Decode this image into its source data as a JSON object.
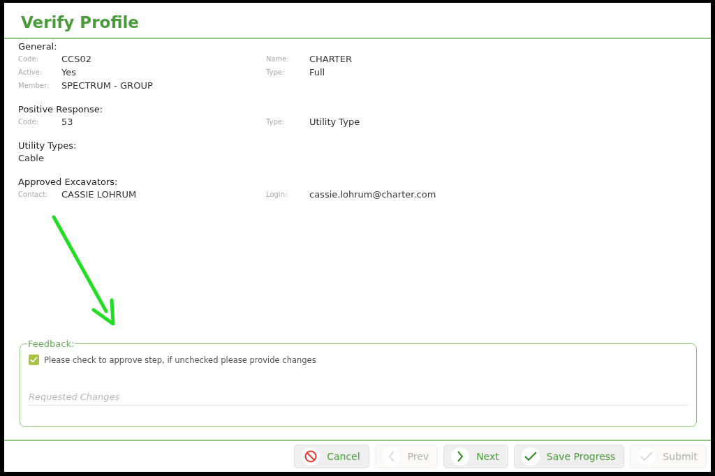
{
  "window": {
    "title": "Verify Profile"
  },
  "sections": [
    {
      "heading": "General:",
      "rows": [
        [
          {
            "label": "Code:",
            "value": "CCS02"
          },
          {
            "label": "Name:",
            "value": "CHARTER"
          }
        ],
        [
          {
            "label": "Active:",
            "value": "Yes"
          },
          {
            "label": "Type:",
            "value": "Full"
          }
        ],
        [
          {
            "label": "Member:",
            "value": "SPECTRUM - GROUP"
          }
        ]
      ]
    },
    {
      "heading": "Positive Response:",
      "rows": [
        [
          {
            "label": "Code:",
            "value": "53"
          },
          {
            "label": "Type:",
            "value": "Utility Type"
          }
        ]
      ]
    },
    {
      "heading": "Utility Types:",
      "text": "Cable"
    },
    {
      "heading": "Approved Excavators:",
      "rows": [
        [
          {
            "label": "Contact:",
            "value": "CASSIE LOHRUM"
          },
          {
            "label": "Login:",
            "value": "cassie.lohrum@charter.com"
          }
        ]
      ]
    }
  ],
  "feedback": {
    "legend": "Feedback:",
    "approve": {
      "label": "Please check to approve step, if unchecked please provide changes",
      "checked": true
    },
    "changes": {
      "placeholder": "Requested Changes"
    }
  },
  "buttons": [
    {
      "kind": "cancel",
      "label": "Cancel",
      "disabled": false
    },
    {
      "kind": "prev",
      "label": "Prev",
      "disabled": true
    },
    {
      "kind": "next",
      "label": "Next",
      "disabled": false
    },
    {
      "kind": "save",
      "label": "Save Progress",
      "disabled": false
    },
    {
      "kind": "submit",
      "label": "Submit",
      "disabled": true
    }
  ]
}
